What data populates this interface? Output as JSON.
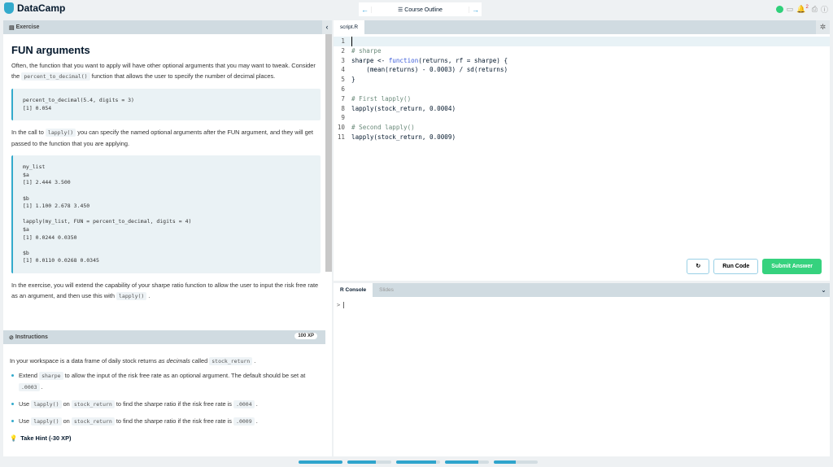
{
  "app": {
    "brand": "DataCamp",
    "nav_label": "Course Outline",
    "notifications": "2"
  },
  "exercise": {
    "header": "Exercise",
    "title": "FUN arguments",
    "p1a": "Often, the function that you want to apply will have other optional arguments that you may want to tweak. Consider the ",
    "p1code": "percent_to_decimal()",
    "p1b": " function that allows the user to specify the number of decimal places.",
    "code1": "percent_to_decimal(5.4, digits = 3)\n[1] 0.054",
    "p2a": "In the call to ",
    "p2code": "lapply()",
    "p2b": " you can specify the named optional arguments after the FUN argument, and they will get passed to the function that you are applying.",
    "code2": "my_list\n$a\n[1] 2.444 3.500\n\n$b\n[1] 1.100 2.678 3.450\n\nlapply(my_list, FUN = percent_to_decimal, digits = 4)\n$a\n[1] 0.0244 0.0350\n\n$b\n[1] 0.0110 0.0268 0.0345",
    "p3a": "In the exercise, you will extend the capability of your sharpe ratio function to allow the user to input the risk free rate as an argument, and then use this with ",
    "p3code": "lapply()",
    "p3b": " ."
  },
  "instructions": {
    "header": "Instructions",
    "xp": "100 XP",
    "intro_a": "In your workspace is a data frame of daily stock returns ",
    "intro_em": "as decimals",
    "intro_b": " called ",
    "intro_code": "stock_return",
    "intro_c": " .",
    "items": [
      {
        "a": "Extend ",
        "c1": "sharpe",
        "b": " to allow the input of the risk free rate as an optional argument. The default should be set at ",
        "c2": ".0003",
        "d": " ."
      },
      {
        "a": "Use ",
        "c1": "lapply()",
        "b": " on ",
        "c2": "stock_return",
        "d": " to find the sharpe ratio if the risk free rate is ",
        "c3": ".0004",
        "e": " ."
      },
      {
        "a": "Use ",
        "c1": "lapply()",
        "b": " on ",
        "c2": "stock_return",
        "d": " to find the sharpe ratio if the risk free rate is ",
        "c3": ".0009",
        "e": " ."
      }
    ],
    "hint": "Take Hint (-30 XP)"
  },
  "editor": {
    "tab": "script.R",
    "lines": [
      "",
      "# sharpe",
      "sharpe <- function(returns, rf = sharpe) {",
      "    (mean(returns) - 0.0003) / sd(returns)",
      "}",
      "",
      "# First lapply()",
      "lapply(stock_return, 0.0004)",
      "",
      "# Second lapply()",
      "lapply(stock_return, 0.0009)"
    ],
    "run": "Run Code",
    "submit": "Submit Answer"
  },
  "console": {
    "tabs": [
      "R Console",
      "Slides"
    ],
    "prompt": ">"
  },
  "progress": [
    100,
    65,
    90,
    75,
    50
  ]
}
